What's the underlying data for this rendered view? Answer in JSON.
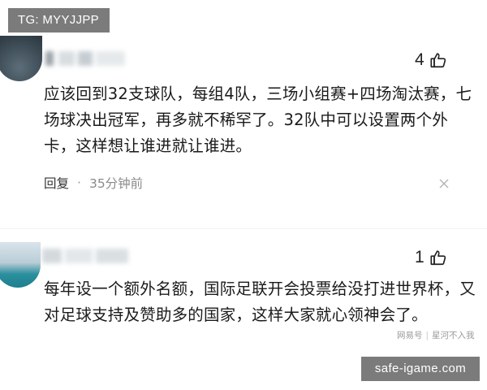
{
  "corner_tag": {
    "text": "TG: MYYJJPP"
  },
  "comments": [
    {
      "username_visible": "忌",
      "likes": "4",
      "text": "应该回到32支球队，每组4队，三场小组赛+四场淘汰赛，七场球决出冠军，再多就不稀罕了。32队中可以设置两个外卡，这样想让谁进就让谁进。",
      "reply_label": "回复",
      "separator": "·",
      "time": "35分钟前"
    },
    {
      "likes": "1",
      "text": "每年设一个额外名额，国际足联开会投票给没打进世界杯，又对足球支持及赞助多的国家，这样大家就心领神会了。"
    }
  ],
  "watermark": {
    "brand": "网易号",
    "separator": "|",
    "author": "星河不入我"
  },
  "site_label": "safe-igame.com",
  "icons": {
    "like": "thumbs-up-icon",
    "close": "close-icon"
  },
  "colors": {
    "tag_bg": "#7b7b7b",
    "text": "#1a1a1a",
    "meta": "#8a8a8a"
  }
}
